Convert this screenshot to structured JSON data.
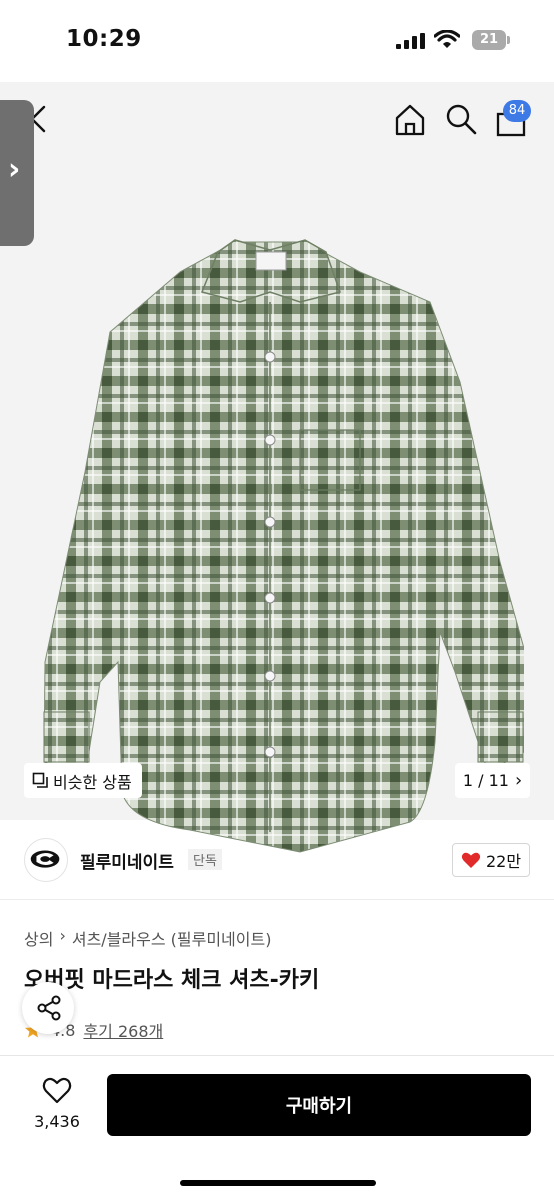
{
  "status_bar": {
    "time": "10:29",
    "battery": "21"
  },
  "nav": {
    "cart_count": "84"
  },
  "gallery": {
    "similar_label": "비슷한 상품",
    "pager": "1 / 11"
  },
  "brand": {
    "name": "필루미네이트",
    "exclusive_badge": "단독",
    "like_count": "22만"
  },
  "product": {
    "breadcrumb": [
      "상의",
      "셔츠/블라우스 (필루미네이트)"
    ],
    "title": "오버핏 마드라스 체크 셔츠-카키",
    "rating": "4.8",
    "reviews": "후기 268개"
  },
  "bottom": {
    "wish_count": "3,436",
    "buy_label": "구매하기"
  },
  "colors": {
    "accent": "#3d7ae5",
    "heart": "#e12b2b",
    "shirt": "#5a6e4f"
  },
  "icons": [
    "back-icon",
    "home-icon",
    "search-icon",
    "bag-icon",
    "chevron-right-icon",
    "similar-icon",
    "heart-icon",
    "star-icon",
    "share-icon"
  ]
}
